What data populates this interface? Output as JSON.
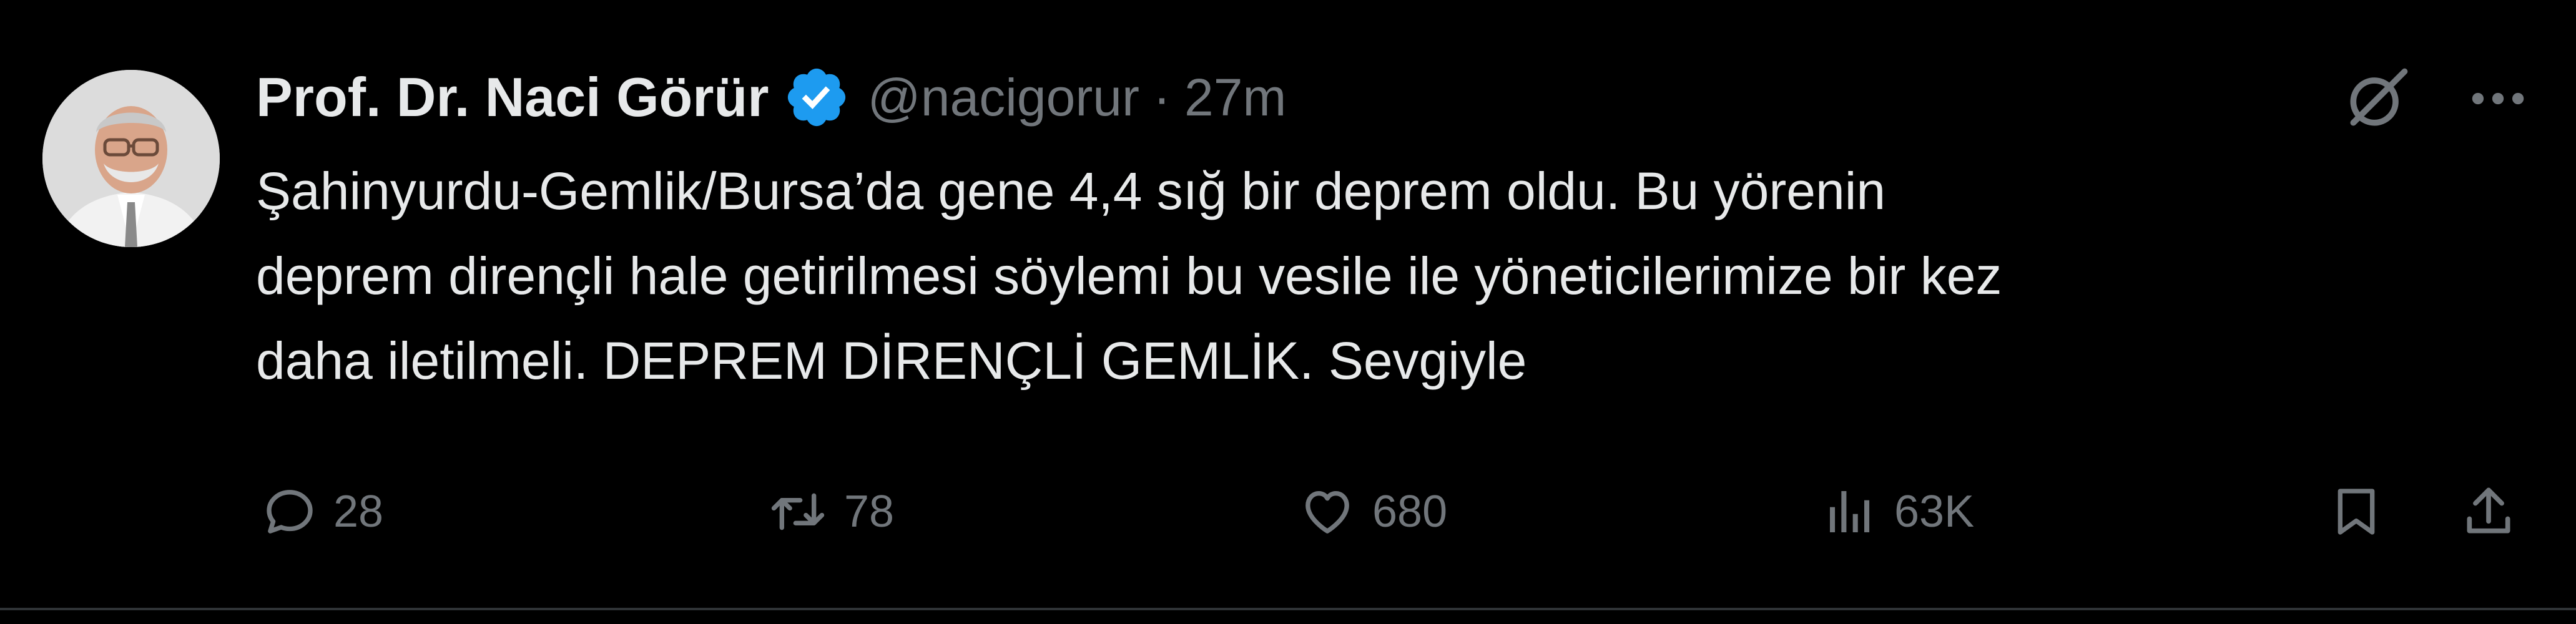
{
  "tweet": {
    "author_name": "Prof. Dr. Naci Görür",
    "handle": "@nacigorur",
    "separator": "·",
    "time": "27m",
    "text_lines": [
      "Şahinyurdu-Gemlik/Bursa’da gene 4,4 sığ bir deprem oldu. Bu yörenin",
      "deprem dirençli hale getirilmesi söylemi bu vesile ile yöneticilerimize bir kez",
      "daha iletilmeli. DEPREM DİRENÇLİ GEMLİK. Sevgiyle"
    ],
    "stats": {
      "replies": "28",
      "retweets": "78",
      "likes": "680",
      "views": "63K"
    }
  },
  "icons": {
    "verified": "verified-badge-icon",
    "grok": "grok-icon",
    "more": "more-icon",
    "reply": "reply-icon",
    "retweet": "retweet-icon",
    "like": "heart-icon",
    "views": "views-icon",
    "bookmark": "bookmark-icon",
    "share": "share-icon"
  },
  "colors": {
    "background": "#000000",
    "text": "#e7e9ea",
    "muted": "#71767b",
    "verified": "#1d9bf0",
    "divider": "#2f3336"
  }
}
